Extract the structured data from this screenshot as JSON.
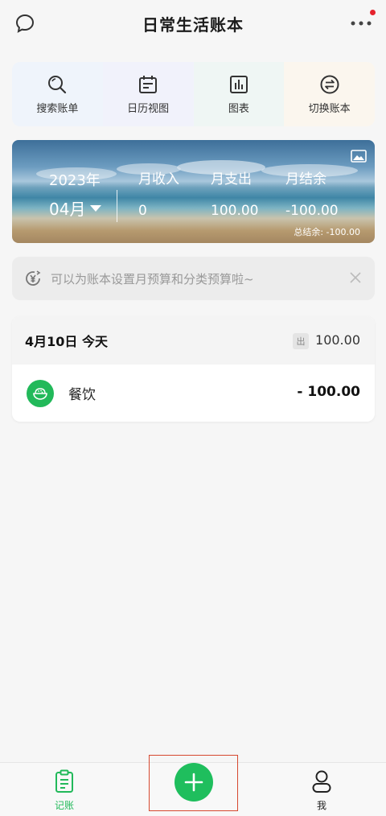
{
  "header": {
    "title": "日常生活账本"
  },
  "quick_actions": [
    {
      "label": "搜索账单",
      "icon": "search-icon"
    },
    {
      "label": "日历视图",
      "icon": "calendar-icon"
    },
    {
      "label": "图表",
      "icon": "chart-icon"
    },
    {
      "label": "切换账本",
      "icon": "switch-icon"
    }
  ],
  "summary": {
    "year": "2023年",
    "month": "04月",
    "income_label": "月收入",
    "income_value": "0",
    "expense_label": "月支出",
    "expense_value": "100.00",
    "balance_label": "月结余",
    "balance_value": "-100.00",
    "total_balance": "总结余: -100.00"
  },
  "budget_tip": {
    "text": "可以为账本设置月预算和分类预算啦~"
  },
  "day": {
    "title": "4月10日 今天",
    "out_tag": "出",
    "out_amount": "100.00",
    "entries": [
      {
        "category": "餐饮",
        "amount": "- 100.00",
        "icon": "rice-bowl-icon"
      }
    ]
  },
  "tabbar": {
    "ledger_label": "记账",
    "me_label": "我"
  },
  "colors": {
    "accent": "#22b95a",
    "highlight_border": "#d6482f",
    "notify_dot": "#e5222d"
  }
}
